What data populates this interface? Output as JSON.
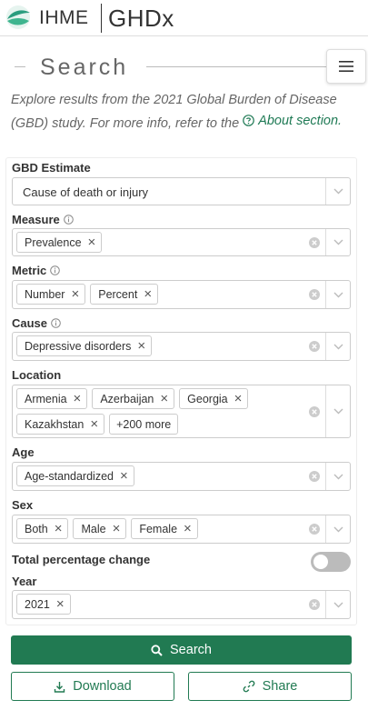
{
  "header": {
    "org_name": "IHME",
    "app_name": "GHDx"
  },
  "search_section": {
    "title": "Search",
    "intro_text": "Explore results from the 2021 Global Burden of Disease (GBD) study. For more info, refer to the",
    "about_link": "About section."
  },
  "filters": {
    "gbd_estimate": {
      "label": "GBD Estimate",
      "value": "Cause of death or injury"
    },
    "measure": {
      "label": "Measure",
      "chips": [
        "Prevalence"
      ]
    },
    "metric": {
      "label": "Metric",
      "chips": [
        "Number",
        "Percent"
      ]
    },
    "cause": {
      "label": "Cause",
      "chips": [
        "Depressive disorders"
      ]
    },
    "location": {
      "label": "Location",
      "chips": [
        "Armenia",
        "Azerbaijan",
        "Georgia",
        "Kazakhstan"
      ],
      "more": "+200 more"
    },
    "age": {
      "label": "Age",
      "chips": [
        "Age-standardized"
      ]
    },
    "sex": {
      "label": "Sex",
      "chips": [
        "Both",
        "Male",
        "Female"
      ]
    },
    "total_percentage_change": {
      "label": "Total percentage change",
      "enabled": false
    },
    "year": {
      "label": "Year",
      "chips": [
        "2021"
      ]
    }
  },
  "actions": {
    "search": "Search",
    "download": "Download",
    "share": "Share"
  },
  "colors": {
    "brand_green": "#217a52",
    "logo_teal": "#2a9d7e"
  },
  "icons": {
    "chip_remove": "×"
  }
}
